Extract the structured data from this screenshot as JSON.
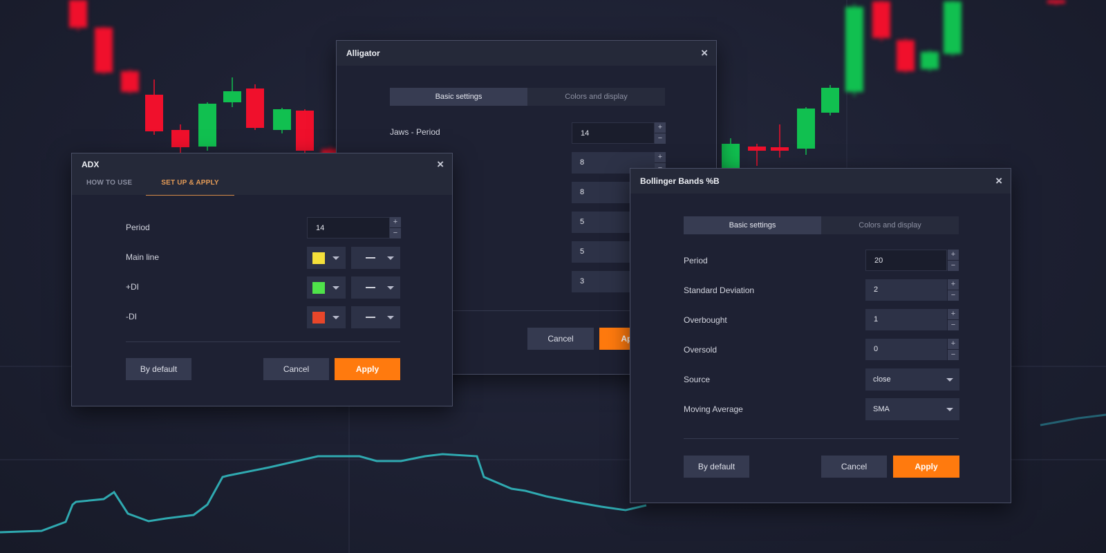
{
  "background": {
    "candle_colors": {
      "bull": "#11c050",
      "bear": "#f0102c"
    },
    "line_color": "#2fb0a8"
  },
  "adx": {
    "title": "ADX",
    "tabs": [
      {
        "label": "HOW TO USE",
        "active": false
      },
      {
        "label": "SET UP & APPLY",
        "active": true
      }
    ],
    "period_label": "Period",
    "period_value": "14",
    "rows": [
      {
        "label": "Main line",
        "color": "#f5e03a",
        "line_style": "solid"
      },
      {
        "label": "+DI",
        "color": "#4fe34a",
        "line_style": "solid"
      },
      {
        "label": "-DI",
        "color": "#e8462a",
        "line_style": "solid"
      }
    ],
    "by_default": "By default",
    "cancel": "Cancel",
    "apply": "Apply"
  },
  "alligator": {
    "title": "Alligator",
    "tabs": [
      "Basic settings",
      "Colors and display"
    ],
    "rows": [
      {
        "label": "Jaws - Period",
        "value": "14"
      },
      {
        "label": "",
        "value": "8"
      },
      {
        "label": "",
        "value": "8"
      },
      {
        "label": "",
        "value": "5"
      },
      {
        "label": "",
        "value": "5"
      },
      {
        "label": "",
        "value": "3"
      }
    ],
    "cancel": "Cancel",
    "apply": "Apply"
  },
  "bollinger": {
    "title": "Bollinger Bands %B",
    "tabs": [
      "Basic settings",
      "Colors and display"
    ],
    "fields": [
      {
        "label": "Period",
        "value": "20"
      },
      {
        "label": "Standard Deviation",
        "value": "2"
      },
      {
        "label": "Overbought",
        "value": "1"
      },
      {
        "label": "Oversold",
        "value": "0"
      }
    ],
    "selects": [
      {
        "label": "Source",
        "value": "close"
      },
      {
        "label": "Moving Average",
        "value": "SMA"
      }
    ],
    "by_default": "By default",
    "cancel": "Cancel",
    "apply": "Apply"
  },
  "icons": {
    "close": "×",
    "plus": "+",
    "minus": "−"
  }
}
